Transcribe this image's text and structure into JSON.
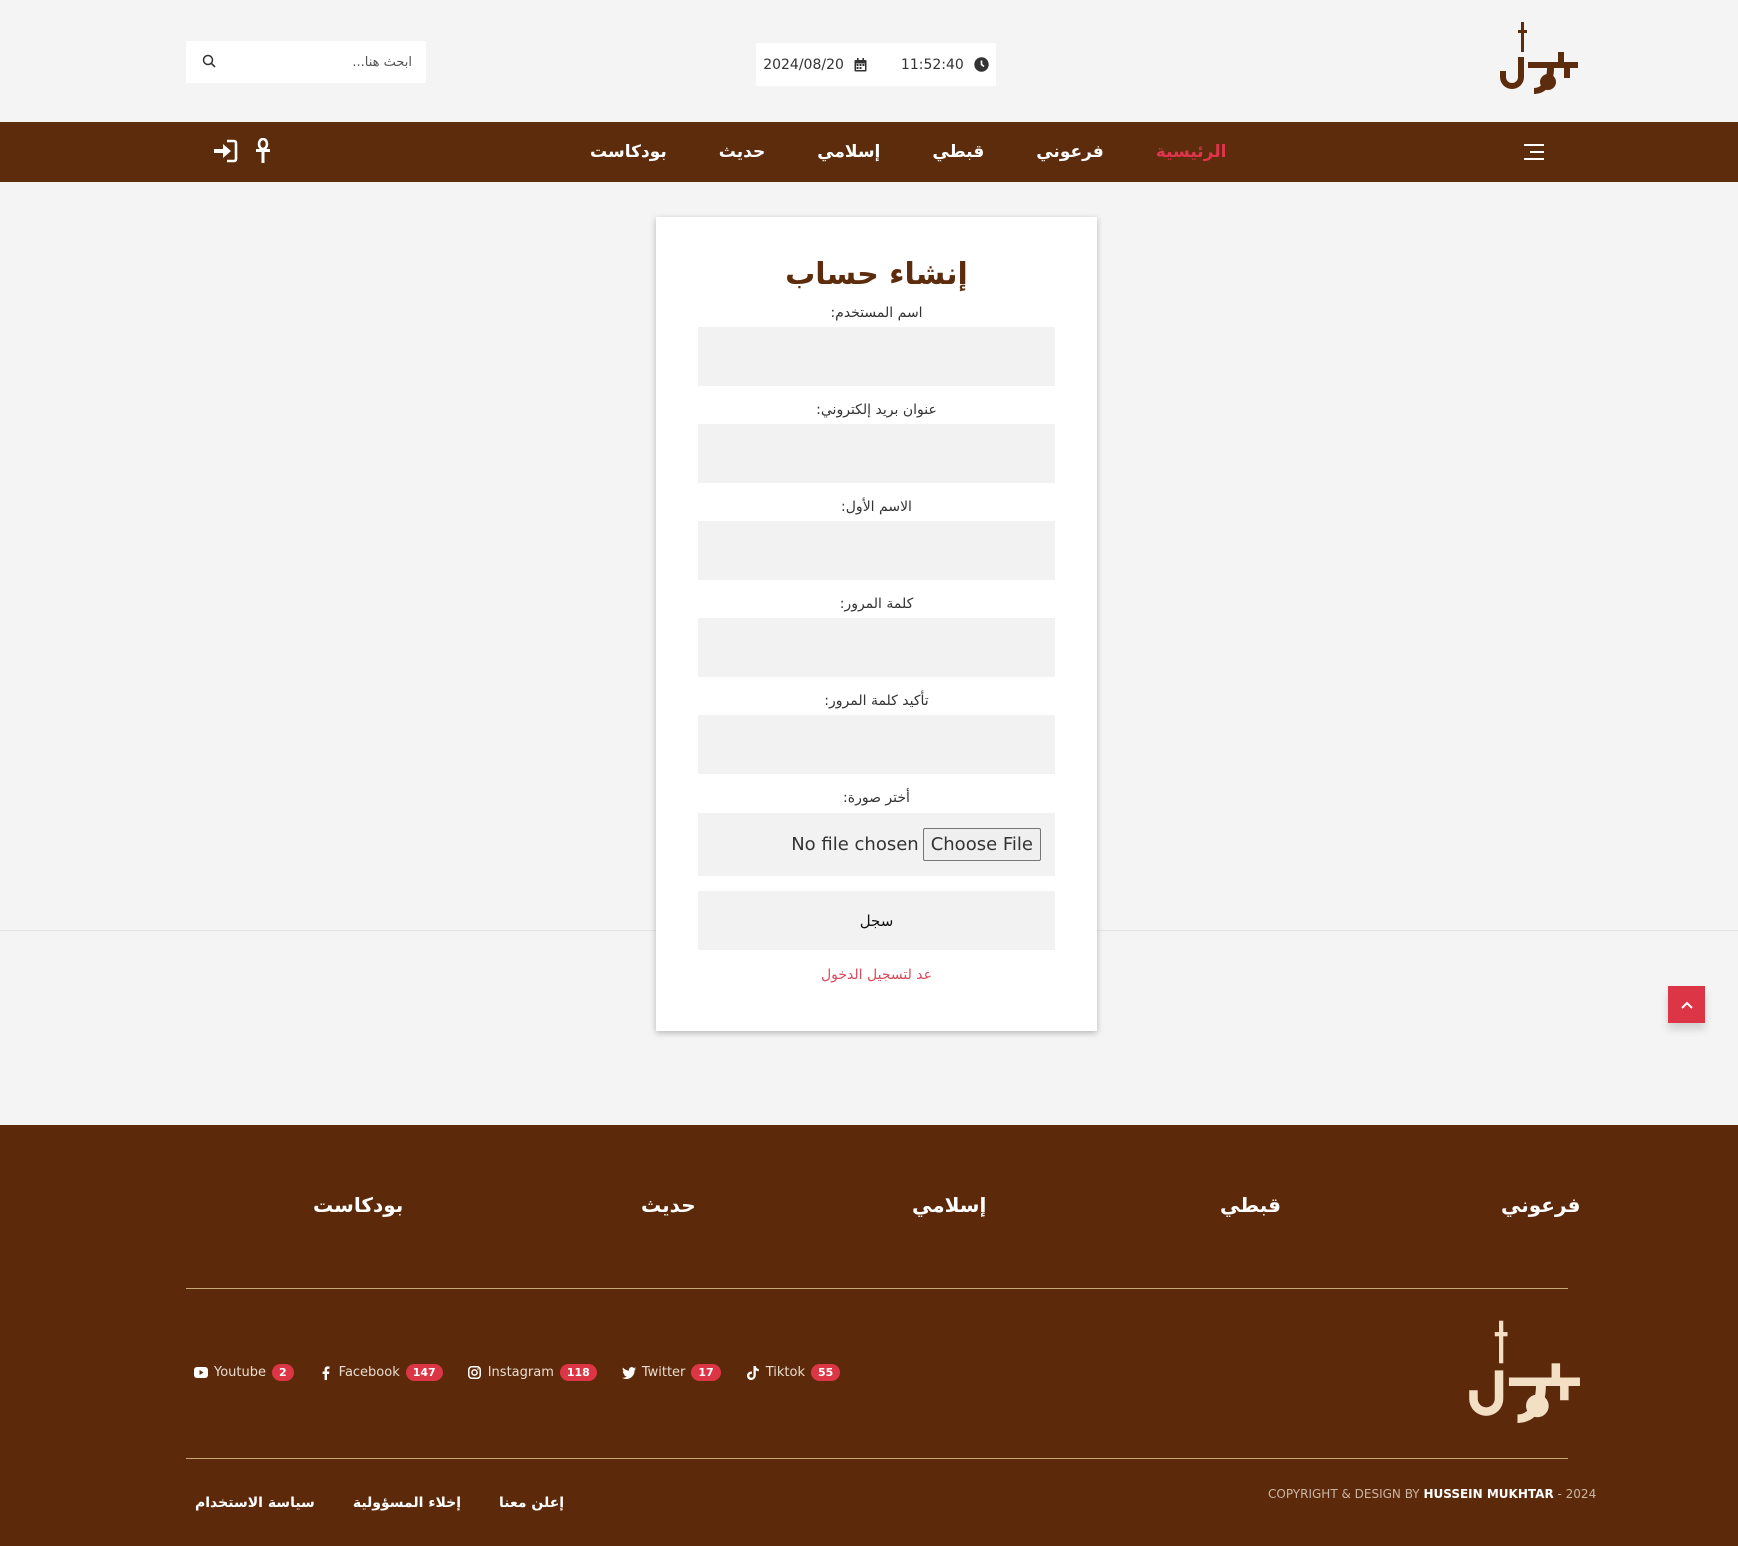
{
  "header": {
    "time": "11:52:40",
    "date": "2024/08/20",
    "search_placeholder": "ابحث هنا..."
  },
  "nav": {
    "items": [
      {
        "label": "الرئيسية",
        "active": true
      },
      {
        "label": "فرعوني"
      },
      {
        "label": "قبطي"
      },
      {
        "label": "إسلامي"
      },
      {
        "label": "حديث"
      },
      {
        "label": "بودكاست"
      }
    ]
  },
  "form": {
    "title": "إنشاء حساب",
    "username_label": "اسم المستخدم:",
    "email_label": "عنوان بريد إلكتروني:",
    "firstname_label": "الاسم الأول:",
    "password_label": "كلمة المرور:",
    "confirm_label": "تأكيد كلمة المرور:",
    "image_label": "أختر صورة:",
    "file_status": "No file chosen",
    "file_button": "Choose File",
    "submit_label": "سجل",
    "login_link": "عد لتسجيل الدخول"
  },
  "footer": {
    "links": [
      "فرعوني",
      "قبطي",
      "إسلامي",
      "حديث",
      "بودكاست"
    ],
    "socials": [
      {
        "name": "Youtube",
        "count": "2",
        "icon": "youtube-icon"
      },
      {
        "name": "Facebook",
        "count": "147",
        "icon": "facebook-icon"
      },
      {
        "name": "Instagram",
        "count": "118",
        "icon": "instagram-icon"
      },
      {
        "name": "Twitter",
        "count": "17",
        "icon": "twitter-icon"
      },
      {
        "name": "Tiktok",
        "count": "55",
        "icon": "tiktok-icon"
      }
    ],
    "copyright_prefix": "COPYRIGHT & DESIGN BY",
    "copyright_author": "HUSSEIN MUKHTAR",
    "copyright_year": "- 2024",
    "legal": [
      "سياسة الاستخدام",
      "إخلاء المسؤولية",
      "إعلن معنا"
    ]
  },
  "colors": {
    "brand_brown": "#5c2c0c",
    "active_red": "#e0344d",
    "badge_red": "#dc3545",
    "page_bg": "#f4f4f4"
  }
}
